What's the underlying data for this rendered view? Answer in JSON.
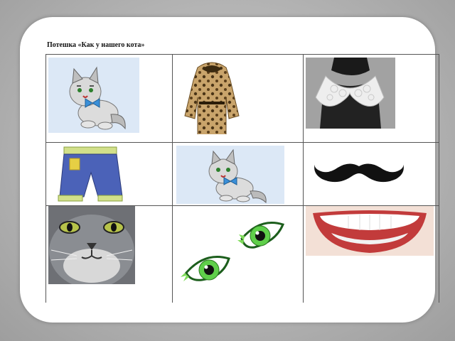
{
  "title": "Потешка «Как у нашего кота»",
  "cells": [
    {
      "name": "kitten-picture"
    },
    {
      "name": "fur-coat-picture"
    },
    {
      "name": "lace-collar-picture"
    },
    {
      "name": "trousers-picture"
    },
    {
      "name": "kitten-picture-2"
    },
    {
      "name": "mustache-picture"
    },
    {
      "name": "cat-face-picture"
    },
    {
      "name": "green-eyes-picture"
    },
    {
      "name": "teeth-smile-picture"
    }
  ],
  "colors": {
    "page_bg": "#b4b4b4",
    "slide_bg": "#ffffff",
    "grid_line": "#555555"
  }
}
